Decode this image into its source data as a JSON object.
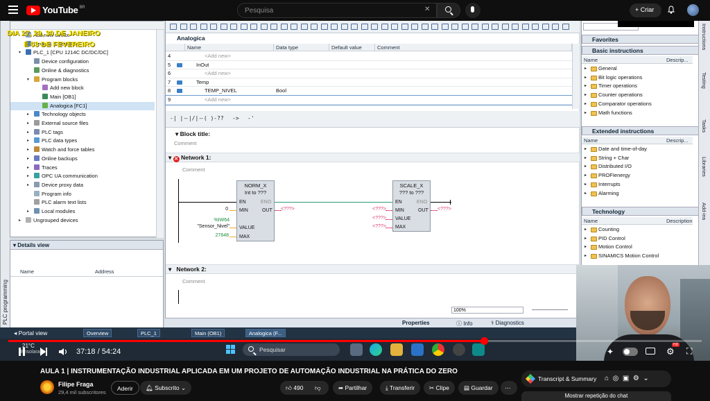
{
  "youtube": {
    "logo_text": "YouTube",
    "logo_region": "BR",
    "search_placeholder": "Pesquisa",
    "create_label": "Criar"
  },
  "tia": {
    "left_vtab": "PLC programming",
    "yellow_note_line1": "DIA 27, 29, 30 DE JANEIRO",
    "yellow_note_line2": "E 03 DE FEVEREIRO",
    "tree": [
      {
        "label": "Add new device",
        "indent": 1
      },
      {
        "label": "Devices & networks",
        "indent": 1
      },
      {
        "label": "PLC_1 [CPU 1214C DC/DC/DC]",
        "indent": 1
      },
      {
        "label": "Device configuration",
        "indent": 2
      },
      {
        "label": "Online & diagnostics",
        "indent": 2
      },
      {
        "label": "Program blocks",
        "indent": 2
      },
      {
        "label": "Add new block",
        "indent": 3
      },
      {
        "label": "Main [OB1]",
        "indent": 3
      },
      {
        "label": "Analogica [FC1]",
        "indent": 3
      },
      {
        "label": "Technology objects",
        "indent": 2
      },
      {
        "label": "External source files",
        "indent": 2
      },
      {
        "label": "PLC tags",
        "indent": 2
      },
      {
        "label": "PLC data types",
        "indent": 2
      },
      {
        "label": "Watch and force tables",
        "indent": 2
      },
      {
        "label": "Online backups",
        "indent": 2
      },
      {
        "label": "Traces",
        "indent": 2
      },
      {
        "label": "OPC UA communication",
        "indent": 2
      },
      {
        "label": "Device proxy data",
        "indent": 2
      },
      {
        "label": "Program info",
        "indent": 2
      },
      {
        "label": "PLC alarm text lists",
        "indent": 2
      },
      {
        "label": "Local modules",
        "indent": 2
      },
      {
        "label": "Ungrouped devices",
        "indent": 1
      }
    ],
    "details_view_label": "Details view",
    "details_cols": [
      "Name",
      "Address"
    ],
    "editor_title": "Analogica",
    "grid_cols": [
      "Name",
      "Data type",
      "Default value",
      "Comment"
    ],
    "grid_rows": [
      {
        "num": "4",
        "name": "<Add new>",
        "type": ""
      },
      {
        "num": "5",
        "name": "InOut",
        "type": ""
      },
      {
        "num": "6",
        "name": "<Add new>",
        "type": ""
      },
      {
        "num": "7",
        "name": "Temp",
        "type": ""
      },
      {
        "num": "8",
        "name": "TEMP_NIVEL",
        "type": "Bool"
      },
      {
        "num": "9",
        "name": "<Add new>",
        "type": ""
      }
    ],
    "ladder_buttons": [
      "-| |-",
      "-|/|-",
      "-( )-",
      "??",
      "->",
      "-'"
    ],
    "block_title_label": "Block title:",
    "comment_label": "Comment",
    "network1_label": "Network 1:",
    "network2_label": "Network 2:",
    "norm": {
      "name": "NORM_X",
      "types": "Int  to  ???",
      "en": "EN",
      "eno": "ENO",
      "min": "MIN",
      "out": "OUT",
      "value": "VALUE",
      "max": "MAX",
      "min_val": "0",
      "value_addr": "%IW64",
      "value_tag": "\"Sensor_Nivel\"",
      "max_val": "27648",
      "out_val": "<???>"
    },
    "scale": {
      "name": "SCALE_X",
      "types": "???  to  ???",
      "en": "EN",
      "eno": "ENO",
      "min": "MIN",
      "out": "OUT",
      "value": "VALUE",
      "max": "MAX",
      "min_val": "<???>",
      "value_val": "<???>",
      "max_val": "<???>",
      "out_val": "<???>",
      "en_val": "<???>"
    },
    "zoom": "100%",
    "right_panel": {
      "favorites": "Favorites",
      "basic": "Basic instructions",
      "basic_cols": [
        "Name",
        "Descrip..."
      ],
      "basic_items": [
        "General",
        "Bit logic operations",
        "Timer operations",
        "Counter operations",
        "Comparator operations",
        "Math functions"
      ],
      "extended": "Extended instructions",
      "extended_cols": [
        "Name",
        "Descrip..."
      ],
      "extended_items": [
        "Date and time-of-day",
        "String + Char",
        "Distributed I/O",
        "PROFIenergy",
        "Interrupts",
        "Alarming"
      ],
      "technology": "Technology",
      "technology_cols": [
        "Name",
        "Description"
      ],
      "technology_items": [
        "Counting",
        "PID Control",
        "Motion Control",
        "SINAMICS Motion Control"
      ]
    },
    "right_tabs": [
      "Instructions",
      "Testing",
      "Tasks",
      "Libraries",
      "Add-ins"
    ],
    "inspector_tabs": [
      "Properties",
      "Info",
      "Diagnostics"
    ],
    "portal_view": "Portal view",
    "bottom_tabs": [
      "Overview",
      "PLC_1",
      "Main (OB1)",
      "Analogica (F..."
    ],
    "taskbar_search": "Pesquisar",
    "weather_temp": "21°C",
    "weather_desc": "Ensolarado"
  },
  "player": {
    "time": "37:18 / 54:24",
    "progress": 0.686
  },
  "video_info": {
    "title": "AULA 1 | INSTRUMENTAÇÃO INDUSTRIAL APLICADA EM UM PROJETO DE AUTOMAÇÃO INDUSTRIAL NA PRÁTICA DO ZERO",
    "channel": "Filipe Fraga",
    "subscribers": "29,4 mil subscritores",
    "join": "Aderir",
    "subscribed": "Subscrito",
    "likes": "490",
    "share": "Partilhar",
    "download": "Transferir",
    "clip": "Clipe",
    "save": "Guardar",
    "transcript": "Transcript & Summary",
    "show_chat": "Mostrar repetição do chat"
  }
}
